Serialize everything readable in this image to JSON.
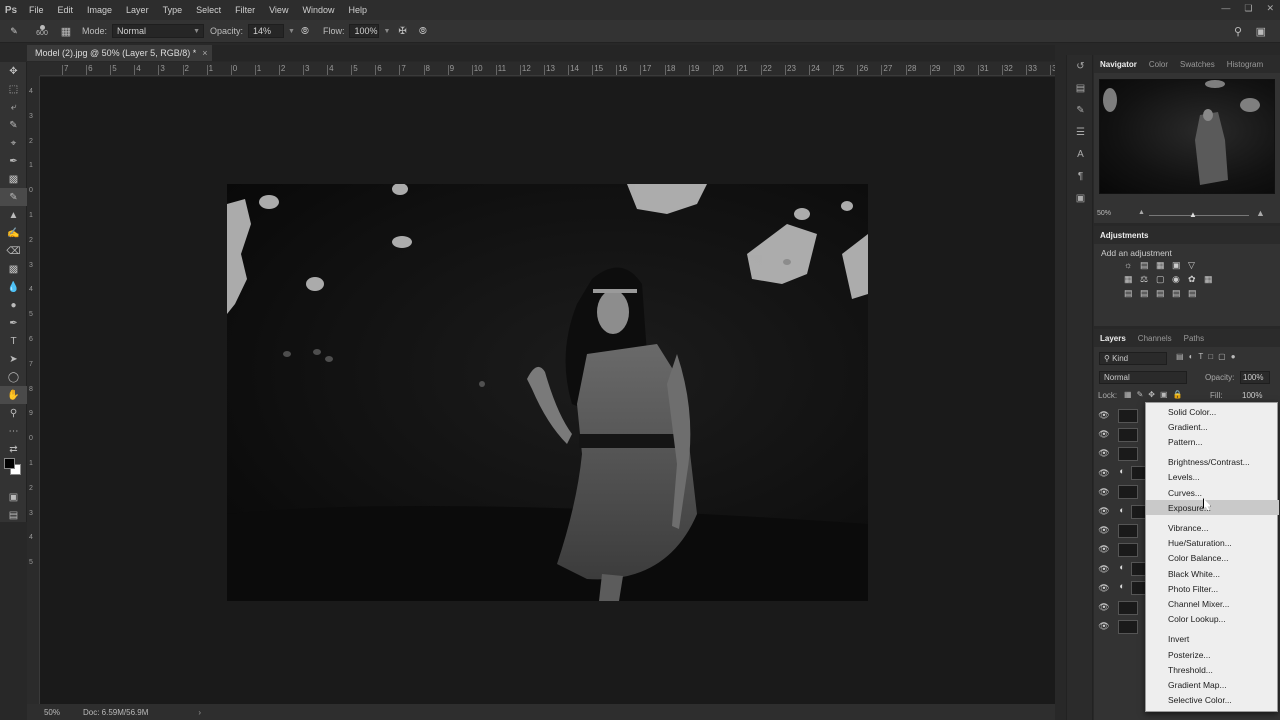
{
  "app": {
    "logo": "Ps"
  },
  "menu": [
    "File",
    "Edit",
    "Image",
    "Layer",
    "Type",
    "Select",
    "Filter",
    "View",
    "Window",
    "Help"
  ],
  "options": {
    "brush_size": "600",
    "mode_label": "Mode:",
    "mode_value": "Normal",
    "opacity_label": "Opacity:",
    "opacity_value": "14%",
    "flow_label": "Flow:",
    "flow_value": "100%"
  },
  "document": {
    "tab_title": "Model (2).jpg @ 50% (Layer 5, RGB/8) *",
    "close": "×"
  },
  "ruler_h": [
    "7",
    "6",
    "5",
    "4",
    "3",
    "2",
    "1",
    "0",
    "1",
    "2",
    "3",
    "4",
    "5",
    "6",
    "7",
    "8",
    "9",
    "10",
    "11",
    "12",
    "13",
    "14",
    "15",
    "16",
    "17",
    "18",
    "19",
    "20",
    "21",
    "22",
    "23",
    "24",
    "25",
    "26",
    "27",
    "28",
    "29",
    "30",
    "31",
    "32",
    "33",
    "34"
  ],
  "ruler_v": [
    "4",
    "3",
    "2",
    "1",
    "0",
    "1",
    "2",
    "3",
    "4",
    "5",
    "6",
    "7",
    "8",
    "9",
    "0",
    "1",
    "2",
    "3",
    "4",
    "5"
  ],
  "status": {
    "zoom": "50%",
    "doc": "Doc: 6.59M/56.9M",
    "arrow": "›"
  },
  "navigator": {
    "tabs": [
      "Navigator",
      "Color",
      "Swatches",
      "Histogram"
    ],
    "zoom": "50%"
  },
  "adjustments": {
    "title": "Adjustments",
    "subtitle": "Add an adjustment"
  },
  "layers": {
    "tabs": [
      "Layers",
      "Channels",
      "Paths"
    ],
    "filter_kind": "Kind",
    "blend_mode": "Normal",
    "opacity_label": "Opacity:",
    "opacity_value": "100%",
    "lock_label": "Lock:",
    "fill_label": "Fill:",
    "fill_value": "100%"
  },
  "adjustment_menu": {
    "items": [
      "Solid Color...",
      "Gradient...",
      "Pattern...",
      "Brightness/Contrast...",
      "Levels...",
      "Curves...",
      "Exposure...",
      "Vibrance...",
      "Hue/Saturation...",
      "Color Balance...",
      "Black  White...",
      "Photo Filter...",
      "Channel Mixer...",
      "Color Lookup...",
      "Invert",
      "Posterize...",
      "Threshold...",
      "Gradient Map...",
      "Selective Color..."
    ],
    "highlighted": "Exposure..."
  }
}
